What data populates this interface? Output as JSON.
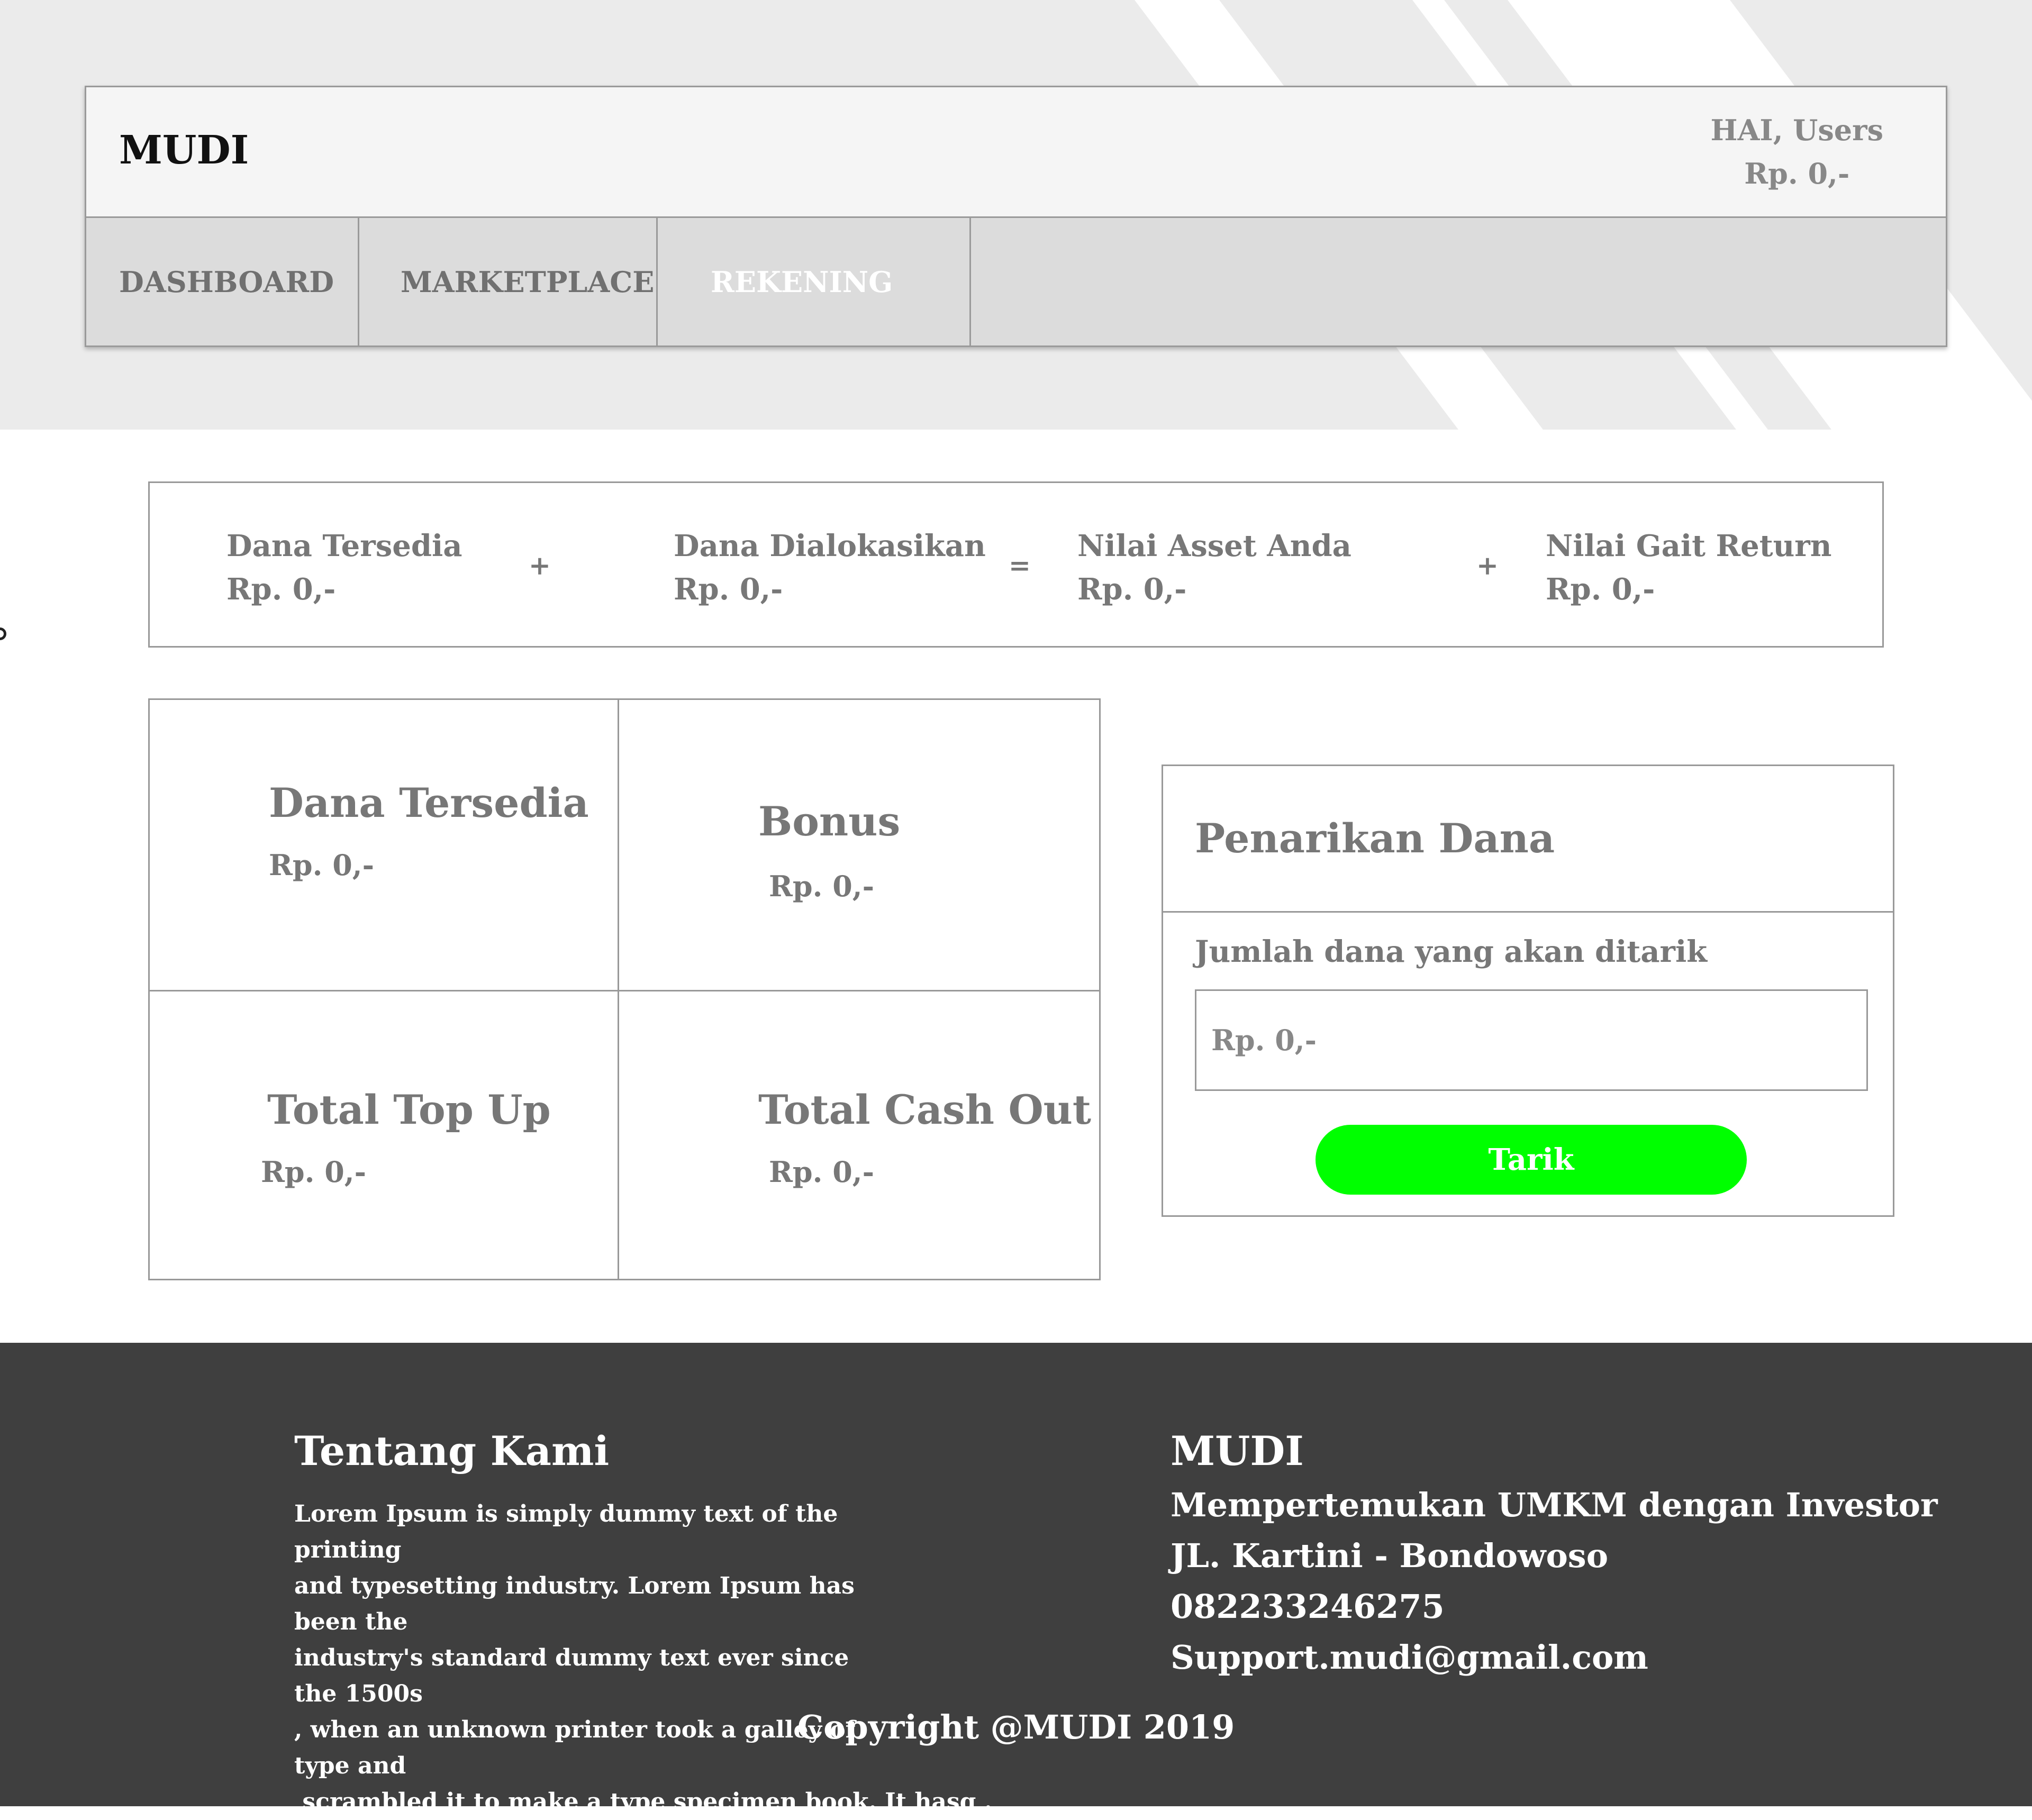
{
  "header": {
    "brand": "MUDI",
    "greeting": "HAI, Users",
    "balance": "Rp. 0,-"
  },
  "nav": {
    "dashboard": "DASHBOARD",
    "marketplace": "MARKETPLACE",
    "rekening": "REKENING",
    "active": "rekening"
  },
  "summary": {
    "items": [
      {
        "label": "Dana Tersedia",
        "value": "Rp. 0,-"
      },
      {
        "label": "Dana Dialokasikan",
        "value": "Rp. 0,-"
      },
      {
        "label": "Nilai Asset Anda",
        "value": "Rp. 0,-"
      },
      {
        "label": "Nilai Gait Return",
        "value": "Rp. 0,-"
      }
    ],
    "operators": [
      "+",
      "=",
      "+"
    ]
  },
  "grid": {
    "cells": [
      {
        "title": "Dana Tersedia",
        "value": "Rp. 0,-"
      },
      {
        "title": "Bonus",
        "value": "Rp. 0,-"
      },
      {
        "title": "Total Top Up",
        "value": "Rp. 0,-"
      },
      {
        "title": "Total Cash Out",
        "value": "Rp. 0,-"
      }
    ]
  },
  "withdraw": {
    "title": "Penarikan Dana",
    "label": "Jumlah dana yang akan ditarik",
    "placeholder": "Rp. 0,-",
    "button": "Tarik",
    "button_color": "#00ff00"
  },
  "footer": {
    "about_title": "Tentang Kami",
    "about_lines": [
      "Lorem Ipsum is simply dummy text of the printing",
      "and typesetting industry. Lorem Ipsum has been the",
      "industry's standard dummy text ever since the 1500s",
      ", when an unknown printer took a galley of type and",
      " scrambled it to make a type specimen book. It hasg ."
    ],
    "brand": "MUDI",
    "tagline": "Mempertemukan UMKM dengan Investor",
    "address": "JL. Kartini - Bondowoso",
    "phone": "082233246275",
    "email": "Support.mudi@gmail.com",
    "copyright": "Copyright @MUDI 2019"
  }
}
